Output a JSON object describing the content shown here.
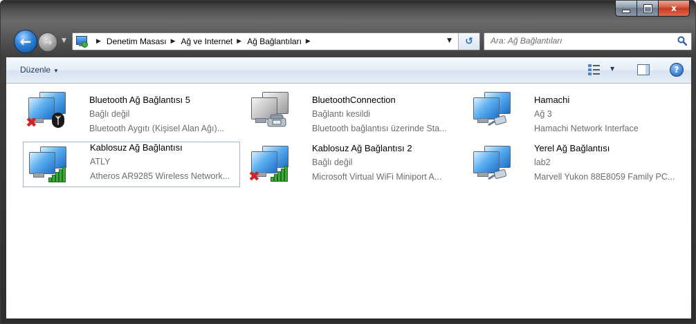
{
  "window": {
    "controls": {
      "minimize": "minimize",
      "maximize": "maximize",
      "close": "x"
    }
  },
  "nav": {
    "breadcrumbs": [
      "Denetim Masası",
      "Ağ ve Internet",
      "Ağ Bağlantıları"
    ],
    "search_placeholder": "Ara: Ağ Bağlantıları"
  },
  "toolbar": {
    "organize_label": "Düzenle"
  },
  "connections": [
    {
      "name": "Bluetooth Ağ Bağlantısı 5",
      "status": "Bağlı değil",
      "device": "Bluetooth Aygıtı (Kişisel Alan Ağı)...",
      "icon": "bluetooth-network-disconnected-icon"
    },
    {
      "name": "BluetoothConnection",
      "status": "Bağlantı kesildi",
      "device": "Bluetooth bağlantısı üzerinde Sta...",
      "icon": "dialup-modem-icon"
    },
    {
      "name": "Hamachi",
      "status": "Ağ  3",
      "device": "Hamachi Network Interface",
      "icon": "wired-network-icon"
    },
    {
      "name": "Kablosuz Ağ Bağlantısı",
      "status": "ATLY",
      "device": "Atheros AR9285 Wireless Network...",
      "icon": "wireless-network-icon",
      "selected": true
    },
    {
      "name": "Kablosuz Ağ Bağlantısı 2",
      "status": "Bağlı değil",
      "device": "Microsoft Virtual WiFi Miniport A...",
      "icon": "wireless-network-disconnected-icon"
    },
    {
      "name": "Yerel Ağ Bağlantısı",
      "status": "lab2",
      "device": "Marvell Yukon 88E8059 Family PC...",
      "icon": "wired-network-icon"
    }
  ]
}
